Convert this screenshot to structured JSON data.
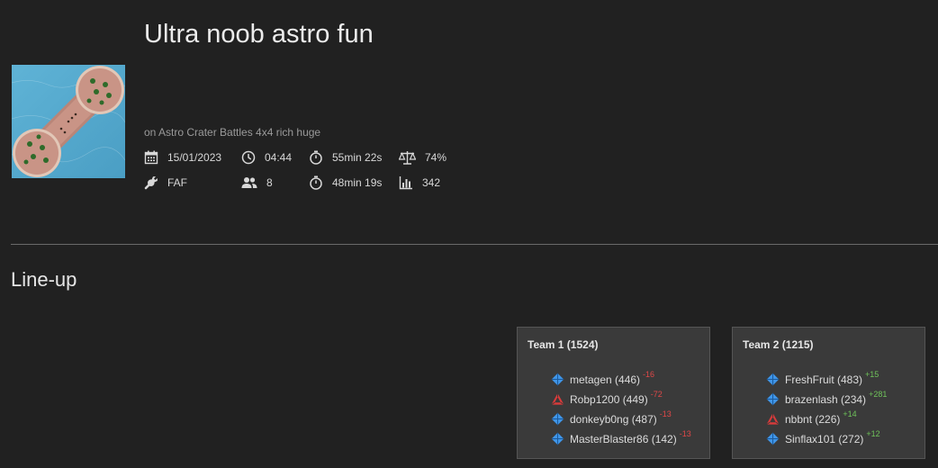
{
  "game": {
    "title": "Ultra noob astro fun",
    "map_line": "on Astro Crater Battles 4x4 rich huge",
    "stats": {
      "date": "15/01/2023",
      "time": "04:44",
      "duration": "55min 22s",
      "quality": "74%",
      "featured_mod": "FAF",
      "player_count": "8",
      "game_time": "48min 19s",
      "rating": "342"
    }
  },
  "lineup": {
    "title": "Line-up",
    "teams": [
      {
        "header": "Team 1 (1524)",
        "players": [
          {
            "name": "metagen (446)",
            "delta": "-16",
            "faction": "uef-icon"
          },
          {
            "name": "Robp1200 (449)",
            "delta": "-72",
            "faction": "cybran-icon"
          },
          {
            "name": "donkeyb0ng (487)",
            "delta": "-13",
            "faction": "uef-icon"
          },
          {
            "name": "MasterBlaster86 (142)",
            "delta": "-13",
            "faction": "uef-icon"
          }
        ]
      },
      {
        "header": "Team 2 (1215)",
        "players": [
          {
            "name": "FreshFruit (483)",
            "delta": "+15",
            "faction": "uef-icon"
          },
          {
            "name": "brazenlash (234)",
            "delta": "+281",
            "faction": "uef-icon"
          },
          {
            "name": "nbbnt (226)",
            "delta": "+14",
            "faction": "cybran-icon"
          },
          {
            "name": "Sinflax101 (272)",
            "delta": "+12",
            "faction": "uef-icon"
          }
        ]
      }
    ]
  },
  "colors": {
    "background": "#212121",
    "card": "#3a3a3a",
    "negative": "#e04848",
    "positive": "#6fc25a",
    "uef": "#3f95e8",
    "cybran": "#d93b3b"
  }
}
